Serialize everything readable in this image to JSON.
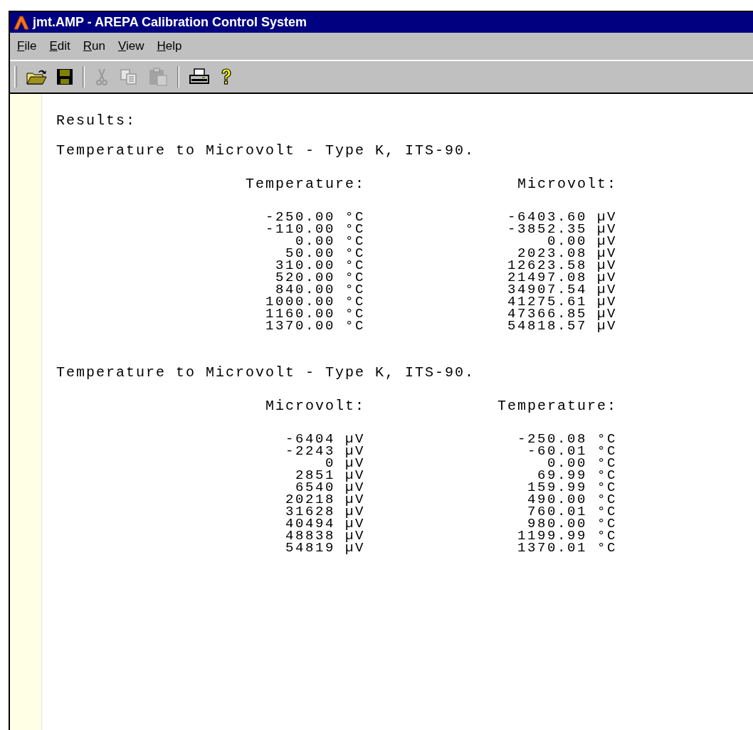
{
  "window": {
    "title": "jmt.AMP - AREPA Calibration Control System"
  },
  "menu": [
    {
      "label": "File"
    },
    {
      "label": "Edit"
    },
    {
      "label": "Run"
    },
    {
      "label": "View"
    },
    {
      "label": "Help"
    }
  ],
  "toolbar": [
    {
      "kind": "open",
      "disabled": false
    },
    {
      "kind": "save",
      "disabled": false
    },
    {
      "kind": "separator"
    },
    {
      "kind": "cut",
      "disabled": true
    },
    {
      "kind": "copy",
      "disabled": true
    },
    {
      "kind": "paste",
      "disabled": true
    },
    {
      "kind": "separator"
    },
    {
      "kind": "print",
      "disabled": false
    },
    {
      "kind": "help",
      "disabled": false
    }
  ],
  "results_label": "Results:",
  "sections": [
    {
      "title": "Temperature to Microvolt - Type K, ITS-90.",
      "columns": [
        "Temperature:",
        "Microvolt:"
      ],
      "rows": [
        [
          "-250.00 °C",
          "-6403.60 µV"
        ],
        [
          "-110.00 °C",
          "-3852.35 µV"
        ],
        [
          "0.00 °C",
          "0.00 µV"
        ],
        [
          "50.00 °C",
          "2023.08 µV"
        ],
        [
          "310.00 °C",
          "12623.58 µV"
        ],
        [
          "520.00 °C",
          "21497.08 µV"
        ],
        [
          "840.00 °C",
          "34907.54 µV"
        ],
        [
          "1000.00 °C",
          "41275.61 µV"
        ],
        [
          "1160.00 °C",
          "47366.85 µV"
        ],
        [
          "1370.00 °C",
          "54818.57 µV"
        ]
      ]
    },
    {
      "title": "Temperature to Microvolt - Type K, ITS-90.",
      "columns": [
        "Microvolt:",
        "Temperature:"
      ],
      "rows": [
        [
          "-6404 µV",
          "-250.08 °C"
        ],
        [
          "-2243 µV",
          "-60.01 °C"
        ],
        [
          "0 µV",
          "0.00 °C"
        ],
        [
          "2851 µV",
          "69.99 °C"
        ],
        [
          "6540 µV",
          "159.99 °C"
        ],
        [
          "20218 µV",
          "490.00 °C"
        ],
        [
          "31628 µV",
          "760.01 °C"
        ],
        [
          "40494 µV",
          "980.00 °C"
        ],
        [
          "48838 µV",
          "1199.99 °C"
        ],
        [
          "54819 µV",
          "1370.01 °C"
        ]
      ]
    }
  ]
}
